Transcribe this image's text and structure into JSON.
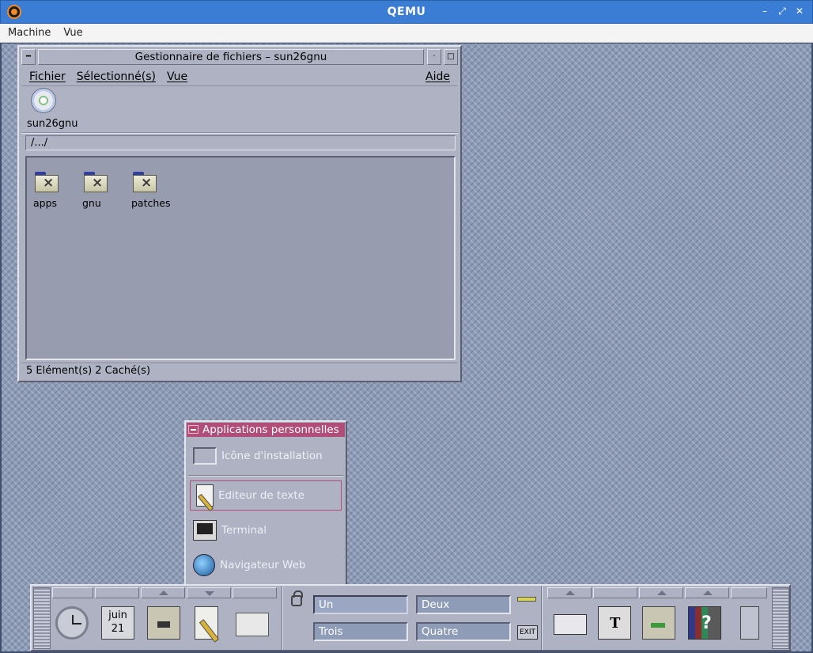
{
  "qemu": {
    "title": "QEMU",
    "menu": [
      "Machine",
      "Vue"
    ],
    "controls": {
      "minimize": "–",
      "restore": "⤢",
      "close": "✕"
    }
  },
  "file_manager": {
    "title": "Gestionnaire de fichiers – sun26gnu",
    "menu": {
      "file": "Fichier",
      "selected": "Sélectionné(s)",
      "view": "Vue",
      "help": "Aide"
    },
    "host_label": "sun26gnu",
    "path": "/.../",
    "folders": [
      {
        "name": "apps"
      },
      {
        "name": "gnu"
      },
      {
        "name": "patches"
      }
    ],
    "status": "5 Elément(s) 2 Caché(s)"
  },
  "subpanel": {
    "title": "Applications personnelles",
    "items": [
      {
        "label": "Icône d'installation",
        "icon": "install-drop-icon"
      },
      {
        "label": "Editeur de texte",
        "icon": "text-editor-icon"
      },
      {
        "label": "Terminal",
        "icon": "terminal-icon"
      },
      {
        "label": "Navigateur Web",
        "icon": "web-browser-icon"
      }
    ]
  },
  "front_panel": {
    "calendar": {
      "month": "juin",
      "day": "21"
    },
    "workspaces": [
      {
        "label": "Un",
        "active": true
      },
      {
        "label": "Deux",
        "active": false
      },
      {
        "label": "Trois",
        "active": false
      },
      {
        "label": "Quatre",
        "active": false
      }
    ],
    "exit_label": "EXIT"
  }
}
